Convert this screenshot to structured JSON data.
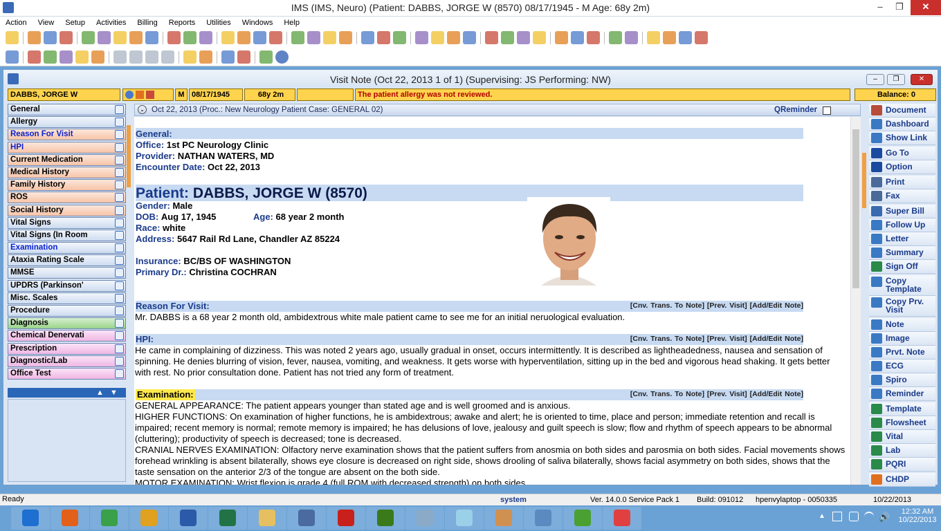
{
  "window": {
    "title": "IMS (IMS, Neuro)    (Patient: DABBS, JORGE W (8570) 08/17/1945  - M Age: 68y 2m)",
    "min": "‒",
    "max": "❐",
    "close": "✕"
  },
  "menu": [
    "Action",
    "View",
    "Setup",
    "Activities",
    "Billing",
    "Reports",
    "Utilities",
    "Windows",
    "Help"
  ],
  "visit": {
    "title": "Visit Note (Oct 22, 2013   1 of 1) (Supervising: JS Performing: NW)"
  },
  "infobar": {
    "name": "DABBS, JORGE W",
    "sex": "M",
    "dob": "08/17/1945",
    "age": "68y 2m",
    "alert": "The patient allergy was not reviewed.",
    "balance": "Balance: 0"
  },
  "nav": [
    {
      "label": "General",
      "c": "blue",
      "h": false
    },
    {
      "label": "Allergy",
      "c": "blue",
      "h": false
    },
    {
      "label": "Reason For Visit",
      "c": "orange",
      "h": true
    },
    {
      "label": "HPI",
      "c": "orange",
      "h": true
    },
    {
      "label": "Current Medication",
      "c": "orange",
      "h": false
    },
    {
      "label": "Medical History",
      "c": "orange",
      "h": false
    },
    {
      "label": "Family History",
      "c": "orange",
      "h": false
    },
    {
      "label": "ROS",
      "c": "orange",
      "h": false
    },
    {
      "label": "Social History",
      "c": "orange",
      "h": false
    },
    {
      "label": "Vital Signs",
      "c": "blue",
      "h": false
    },
    {
      "label": "Vital Signs (In Room",
      "c": "blue",
      "h": false
    },
    {
      "label": "Examination",
      "c": "blue",
      "h": true
    },
    {
      "label": "Ataxia Rating Scale",
      "c": "blue",
      "h": false
    },
    {
      "label": "MMSE",
      "c": "blue",
      "h": false
    },
    {
      "label": "UPDRS (Parkinson'",
      "c": "blue",
      "h": false
    },
    {
      "label": "Misc. Scales",
      "c": "blue",
      "h": false
    },
    {
      "label": "Procedure",
      "c": "blue",
      "h": false
    },
    {
      "label": "Diagnosis",
      "c": "green",
      "h": false
    },
    {
      "label": "Chemical Denervati",
      "c": "pink",
      "h": false
    },
    {
      "label": "Prescription",
      "c": "pink",
      "h": false
    },
    {
      "label": "Diagnostic/Lab",
      "c": "pink",
      "h": false
    },
    {
      "label": "Office Test",
      "c": "pink",
      "h": false
    }
  ],
  "noteheader": {
    "text": "Oct 22, 2013  (Proc.: New Neurology Patient  Case: GENERAL 02)",
    "qreminder": "QReminder"
  },
  "note": {
    "general_hdr": "General:",
    "office_lbl": "Office:",
    "office": "1st PC Neurology Clinic",
    "provider_lbl": "Provider:",
    "provider": "NATHAN WATERS, MD",
    "enc_lbl": "Encounter Date:",
    "enc": "Oct 22, 2013",
    "patient_lbl": "Patient:",
    "patient": "DABBS, JORGE W   (8570)",
    "gender_lbl": "Gender:",
    "gender": "Male",
    "dob_lbl": "DOB:",
    "dob": "Aug 17, 1945",
    "age_lbl": "Age:",
    "age": "68 year 2 month",
    "race_lbl": "Race:",
    "race": "white",
    "addr_lbl": "Address:",
    "addr": "5647 Rail Rd Lane,  Chandler  AZ  85224",
    "ins_lbl": "Insurance:",
    "ins": "BC/BS OF WASHINGTON",
    "pdr_lbl": "Primary Dr.:",
    "pdr": "Christina  COCHRAN",
    "rfv_hdr": "Reason For Visit:",
    "rfv": "Mr. DABBS is a 68 year 2 month old, ambidextrous white male patient came to see me for an initial neruological evaluation.",
    "hpi_hdr": "HPI:",
    "hpi": "He came in complaining of dizziness. This was noted 2 years ago, usually gradual  in onset, occurs intermittently. It is described as lightheadedness, nausea and sensation of spinning. He denies blurring of vision, fever, nausea, vomiting, and weakness. It gets worse with hyperventilation, sitting up in the bed and vigorous head shaking. It gets better with rest. No prior consultation done. Patient has not tried any form of treatment.",
    "exam_hdr": "Examination:",
    "exam": [
      "GENERAL APPEARANCE: The patient appears younger than stated age and is well groomed and is anxious.",
      "HIGHER FUNCTIONS: On examination of higher functions, he is ambidextrous; awake and alert; he is oriented to time, place and person; immediate retention and recall is impaired; recent memory is normal; remote memory is impaired; he has delusions of love, jealousy and guilt speech is slow; flow and rhythm of speech appears to be abnormal (cluttering); productivity of speech is decreased; tone is decreased.",
      "CRANIAL NERVES EXAMINATION: Olfactory nerve examination shows that the patient suffers from anosmia on both sides and parosmia on both sides. Facial movements shows forehead wrinkling is absent bilaterally, shows eye closure is decreased on right side, shows drooling of saliva bilaterally, shows facial asymmetry on both sides, shows that the taste sensation on the anterior 2/3 of the tongue are absent on the both side.",
      "MOTOR EXAMINATION: Wrist flexion is grade 4 (full ROM with decreased strength) on both sides."
    ],
    "links": "[Cnv. Trans. To Note]  [Prev. Visit]  [Add/Edit Note]"
  },
  "right": [
    {
      "label": "Document",
      "c": "#b84a3a"
    },
    {
      "label": "Dashboard",
      "c": "#3a7ac4"
    },
    {
      "label": "Show Link",
      "c": "#3a7ac4"
    },
    {
      "gap": true
    },
    {
      "label": "Go To",
      "c": "#1a4aa0"
    },
    {
      "label": "Option",
      "c": "#1a4aa0"
    },
    {
      "gap": true
    },
    {
      "label": "Print",
      "c": "#4a6a9a"
    },
    {
      "label": "Fax",
      "c": "#4a6a9a"
    },
    {
      "gap": true
    },
    {
      "label": "Super Bill",
      "c": "#3a6ab0"
    },
    {
      "label": "Follow Up",
      "c": "#3a7ac4"
    },
    {
      "label": "Letter",
      "c": "#3a7ac4"
    },
    {
      "label": "Summary",
      "c": "#3a7ac4"
    },
    {
      "label": "Sign Off",
      "c": "#2a8a4a"
    },
    {
      "gap": true
    },
    {
      "label": "Copy Template",
      "c": "#3a7ac4",
      "two": true
    },
    {
      "label": "Copy Prv. Visit",
      "c": "#3a7ac4",
      "two": true
    },
    {
      "gap": true
    },
    {
      "label": "Note",
      "c": "#3a7ac4"
    },
    {
      "label": "Image",
      "c": "#3a7ac4"
    },
    {
      "label": "Prvt. Note",
      "c": "#3a7ac4"
    },
    {
      "label": "ECG",
      "c": "#3a7ac4"
    },
    {
      "label": "Spiro",
      "c": "#3a7ac4"
    },
    {
      "label": "Reminder",
      "c": "#3a7ac4"
    },
    {
      "gap": true
    },
    {
      "label": "Template",
      "c": "#2a8a4a"
    },
    {
      "label": "Flowsheet",
      "c": "#2a8a4a"
    },
    {
      "label": "Vital",
      "c": "#2a8a4a"
    },
    {
      "label": "Lab",
      "c": "#2a8a4a"
    },
    {
      "label": "PQRI",
      "c": "#2a8a4a"
    },
    {
      "gap": true
    },
    {
      "label": "CHDP",
      "c": "#e07020"
    }
  ],
  "status": {
    "ready": "Ready",
    "user": "system",
    "ver": "Ver. 14.0.0 Service Pack 1",
    "build": "Build: 091012",
    "machine": "hpenvylaptop - 0050335",
    "date": "10/22/2013"
  },
  "clock": {
    "time": "12:32 AM",
    "date": "10/22/2013"
  },
  "taskbar": [
    {
      "name": "ie",
      "c": "#1e6fd0"
    },
    {
      "name": "firefox",
      "c": "#e2601a"
    },
    {
      "name": "chrome",
      "c": "#3aa04a"
    },
    {
      "name": "outlook",
      "c": "#e0a020"
    },
    {
      "name": "word",
      "c": "#2a5aa8"
    },
    {
      "name": "excel",
      "c": "#217346"
    },
    {
      "name": "explorer",
      "c": "#e6c060"
    },
    {
      "name": "remote",
      "c": "#4a6aa0"
    },
    {
      "name": "acrobat",
      "c": "#c8201a"
    },
    {
      "name": "dreamweaver",
      "c": "#3a7a1a"
    },
    {
      "name": "calculator",
      "c": "#8aaac8"
    },
    {
      "name": "notes",
      "c": "#9ad0e8"
    },
    {
      "name": "paint",
      "c": "#d09050"
    },
    {
      "name": "settings",
      "c": "#5a8ac0"
    },
    {
      "name": "evernote",
      "c": "#4aa030"
    },
    {
      "name": "ims",
      "c": "#e04040"
    }
  ]
}
